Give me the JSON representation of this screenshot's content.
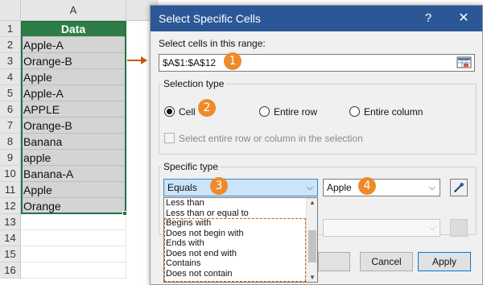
{
  "sheet": {
    "column_header": "A",
    "row_numbers": [
      "1",
      "2",
      "3",
      "4",
      "5",
      "6",
      "7",
      "8",
      "9",
      "10",
      "11",
      "12",
      "13",
      "14",
      "15",
      "16"
    ],
    "header_cell": "Data",
    "cells": [
      "Apple-A",
      "Orange-B",
      "Apple",
      "Apple-A",
      "APPLE",
      "Orange-B",
      "Banana",
      "apple",
      "Banana-A",
      "Apple",
      "Orange"
    ],
    "accent_color": "#217346",
    "header_fill": "#2e7d46"
  },
  "dialog": {
    "title": "Select Specific Cells",
    "help_label": "?",
    "close_label": "✕",
    "range_label": "Select cells in this range:",
    "range_value": "$A$1:$A$12",
    "selection_type": {
      "title": "Selection type",
      "options": [
        "Cell",
        "Entire row",
        "Entire column"
      ],
      "selected": "Cell",
      "checkbox_label": "Select entire row or column in the selection"
    },
    "specific_type": {
      "title": "Specific type",
      "operator_value": "Equals",
      "value": "Apple",
      "operator_options": [
        "Less than",
        "Less than or equal to",
        "Begins with",
        "Does not begin with",
        "Ends with",
        "Does not end with",
        "Contains",
        "Does not contain"
      ]
    },
    "buttons": {
      "cancel": "Cancel",
      "apply": "Apply"
    }
  },
  "badges": [
    "1",
    "2",
    "3",
    "4"
  ],
  "titlebar_color": "#2b5797",
  "badge_color": "#ee8a2a",
  "arrow_color": "#c55a11"
}
